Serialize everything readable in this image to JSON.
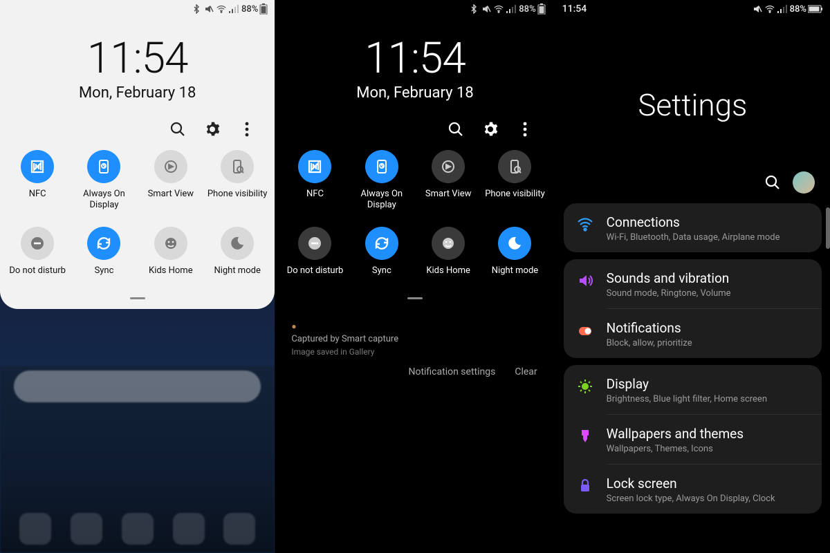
{
  "status": {
    "time": "11:54",
    "battery": "88%"
  },
  "quick": {
    "time": "11:54",
    "date": "Mon, February 18",
    "tiles": [
      {
        "id": "nfc",
        "label": "NFC",
        "on": true,
        "icon": "nfc"
      },
      {
        "id": "aod",
        "label": "Always On Display",
        "on": true,
        "icon": "aod"
      },
      {
        "id": "smartview",
        "label": "Smart View",
        "on": false,
        "icon": "cast"
      },
      {
        "id": "phonevis",
        "label": "Phone visibility",
        "on": false,
        "icon": "phonevis"
      },
      {
        "id": "dnd",
        "label": "Do not disturb",
        "on": false,
        "icon": "dnd"
      },
      {
        "id": "sync",
        "label": "Sync",
        "on": true,
        "icon": "sync"
      },
      {
        "id": "kids",
        "label": "Kids Home",
        "on": false,
        "icon": "kids"
      },
      {
        "id": "night",
        "label": "Night mode",
        "on_light": false,
        "on_dark": true,
        "icon": "moon"
      }
    ]
  },
  "notif": {
    "capture_line1": "Captured by Smart capture",
    "capture_line2": "Image saved in Gallery",
    "settings_btn": "Notification settings",
    "clear_btn": "Clear"
  },
  "settings": {
    "title": "Settings",
    "groups": [
      {
        "items": [
          {
            "name": "Connections",
            "sub": "Wi-Fi, Bluetooth, Data usage, Airplane mode",
            "icon": "wifi",
            "color": "#2e9bff"
          }
        ]
      },
      {
        "items": [
          {
            "name": "Sounds and vibration",
            "sub": "Sound mode, Ringtone, Volume",
            "icon": "sound",
            "color": "#b84dff"
          },
          {
            "name": "Notifications",
            "sub": "Block, allow, prioritize",
            "icon": "notif",
            "color": "#ff6b4d"
          }
        ]
      },
      {
        "items": [
          {
            "name": "Display",
            "sub": "Brightness, Blue light filter, Home screen",
            "icon": "display",
            "color": "#7dd321"
          },
          {
            "name": "Wallpapers and themes",
            "sub": "Wallpapers, Themes, Icons",
            "icon": "brush",
            "color": "#d64dff"
          },
          {
            "name": "Lock screen",
            "sub": "Screen lock type, Always On Display, Clock",
            "icon": "lock",
            "color": "#7a5cff"
          }
        ]
      }
    ]
  }
}
